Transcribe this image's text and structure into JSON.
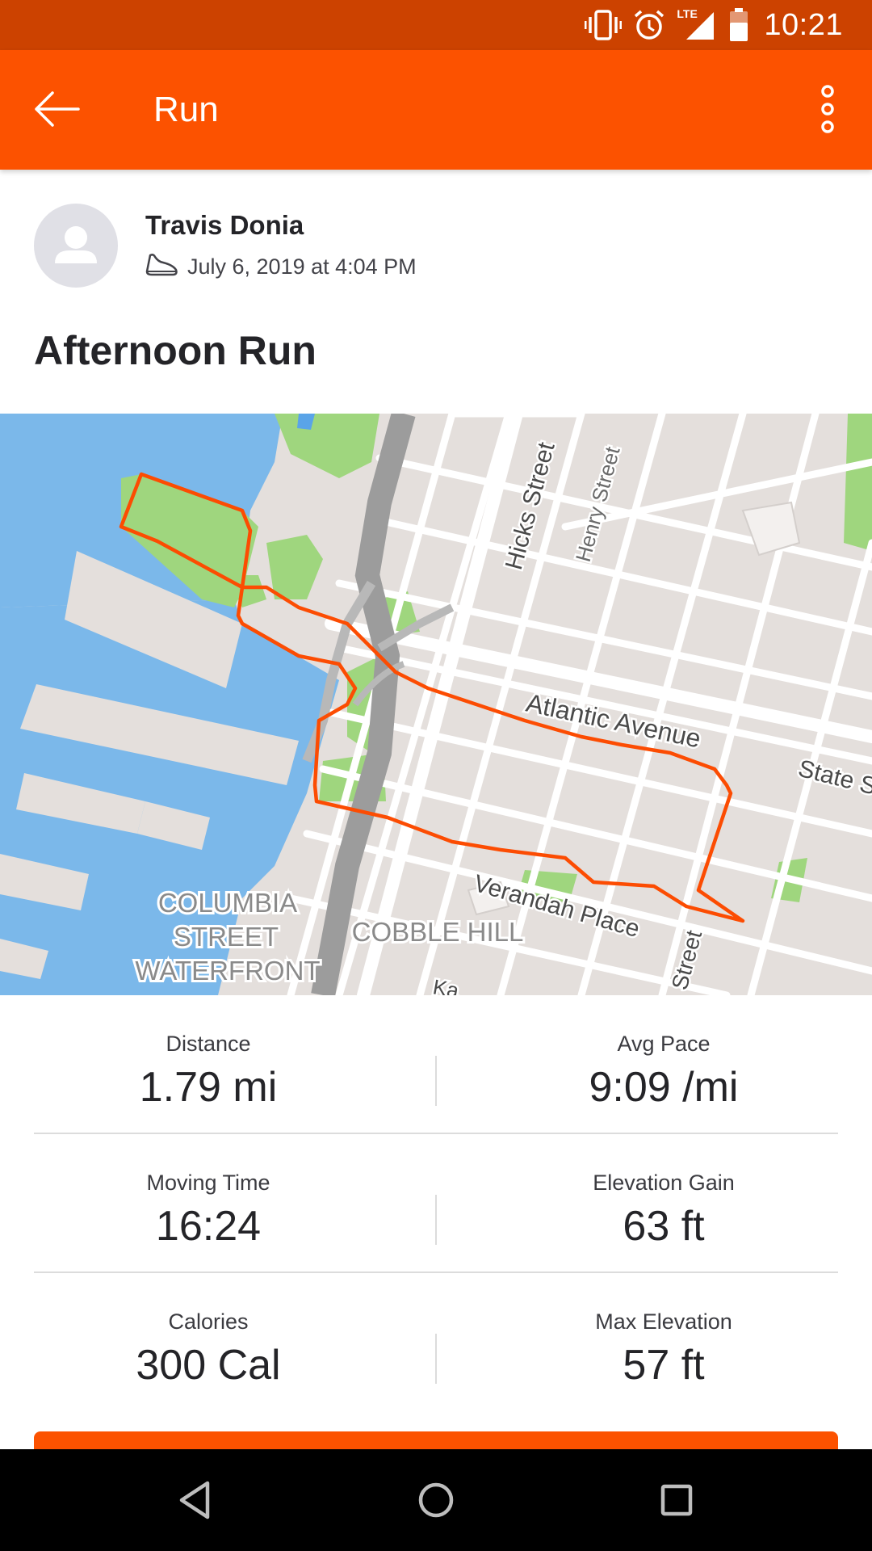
{
  "status_bar": {
    "time": "10:21",
    "network": "LTE",
    "icons": [
      "vibrate-icon",
      "alarm-icon",
      "signal-icon",
      "battery-icon"
    ]
  },
  "app_bar": {
    "title": "Run",
    "back_icon": "arrow-left-icon",
    "more_icon": "more-vertical-icon"
  },
  "activity": {
    "athlete_name": "Travis Donia",
    "date": "July 6, 2019 at 4:04 PM",
    "sport_icon": "shoe-icon",
    "title": "Afternoon Run"
  },
  "map": {
    "streets": {
      "hicks": "Hicks Street",
      "henry": "Henry Street",
      "atlantic": "Atlantic Avenue",
      "state": "State S",
      "verandah": "Verandah Place",
      "street_fragment": "Street",
      "kane_fragment": "Ka"
    },
    "neighborhoods": {
      "columbia_1": "COLUMBIA",
      "columbia_2": "STREET",
      "columbia_3": "WATERFRONT",
      "cobble": "COBBLE HILL"
    }
  },
  "stats": [
    {
      "left_label": "Distance",
      "left_value": "1.79 mi",
      "right_label": "Avg Pace",
      "right_value": "9:09 /mi"
    },
    {
      "left_label": "Moving Time",
      "left_value": "16:24",
      "right_label": "Elevation Gain",
      "right_value": "63 ft"
    },
    {
      "left_label": "Calories",
      "left_value": "300 Cal",
      "right_label": "Max Elevation",
      "right_value": "57 ft"
    }
  ],
  "colors": {
    "brand": "#fc5200",
    "status_bar": "#cc4200",
    "route": "#fc4c02",
    "water": "#6fb3e8",
    "park": "#9fd67e",
    "nav_bar": "#000000"
  },
  "nav_bar": {
    "icons": [
      "back-triangle-icon",
      "home-circle-icon",
      "recents-square-icon"
    ]
  }
}
